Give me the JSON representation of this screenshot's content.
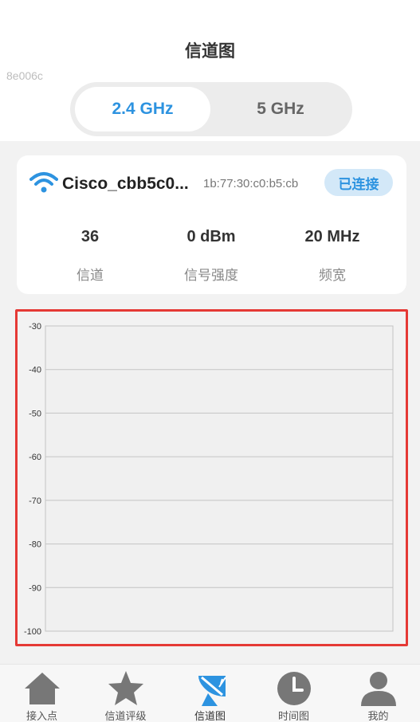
{
  "header": {
    "title": "信道图",
    "tag": "8e006c"
  },
  "bands": {
    "active": "2.4 GHz",
    "inactive": "5 GHz"
  },
  "network": {
    "ssid": "Cisco_cbb5c0...",
    "mac": "1b:77:30:c0:b5:cb",
    "status": "已连接",
    "stats": [
      {
        "value": "36",
        "label": "信道"
      },
      {
        "value": "0 dBm",
        "label": "信号强度"
      },
      {
        "value": "20 MHz",
        "label": "频宽"
      }
    ]
  },
  "chart_data": {
    "type": "line",
    "title": "",
    "xlabel": "",
    "ylabel": "",
    "ylim": [
      -100,
      -30
    ],
    "yticks": [
      "-30",
      "-40",
      "-50",
      "-60",
      "-70",
      "-80",
      "-90",
      "-100"
    ],
    "grid": true,
    "series": []
  },
  "nav": {
    "items": [
      {
        "label": "接入点",
        "icon": "home-icon"
      },
      {
        "label": "信道评级",
        "icon": "star-icon"
      },
      {
        "label": "信道图",
        "icon": "satellite-dish-icon"
      },
      {
        "label": "时间图",
        "icon": "clock-icon"
      },
      {
        "label": "我的",
        "icon": "user-icon"
      }
    ]
  },
  "colors": {
    "accent": "#2d93e0",
    "highlight_border": "#e53935",
    "icon_gray": "#777777"
  }
}
